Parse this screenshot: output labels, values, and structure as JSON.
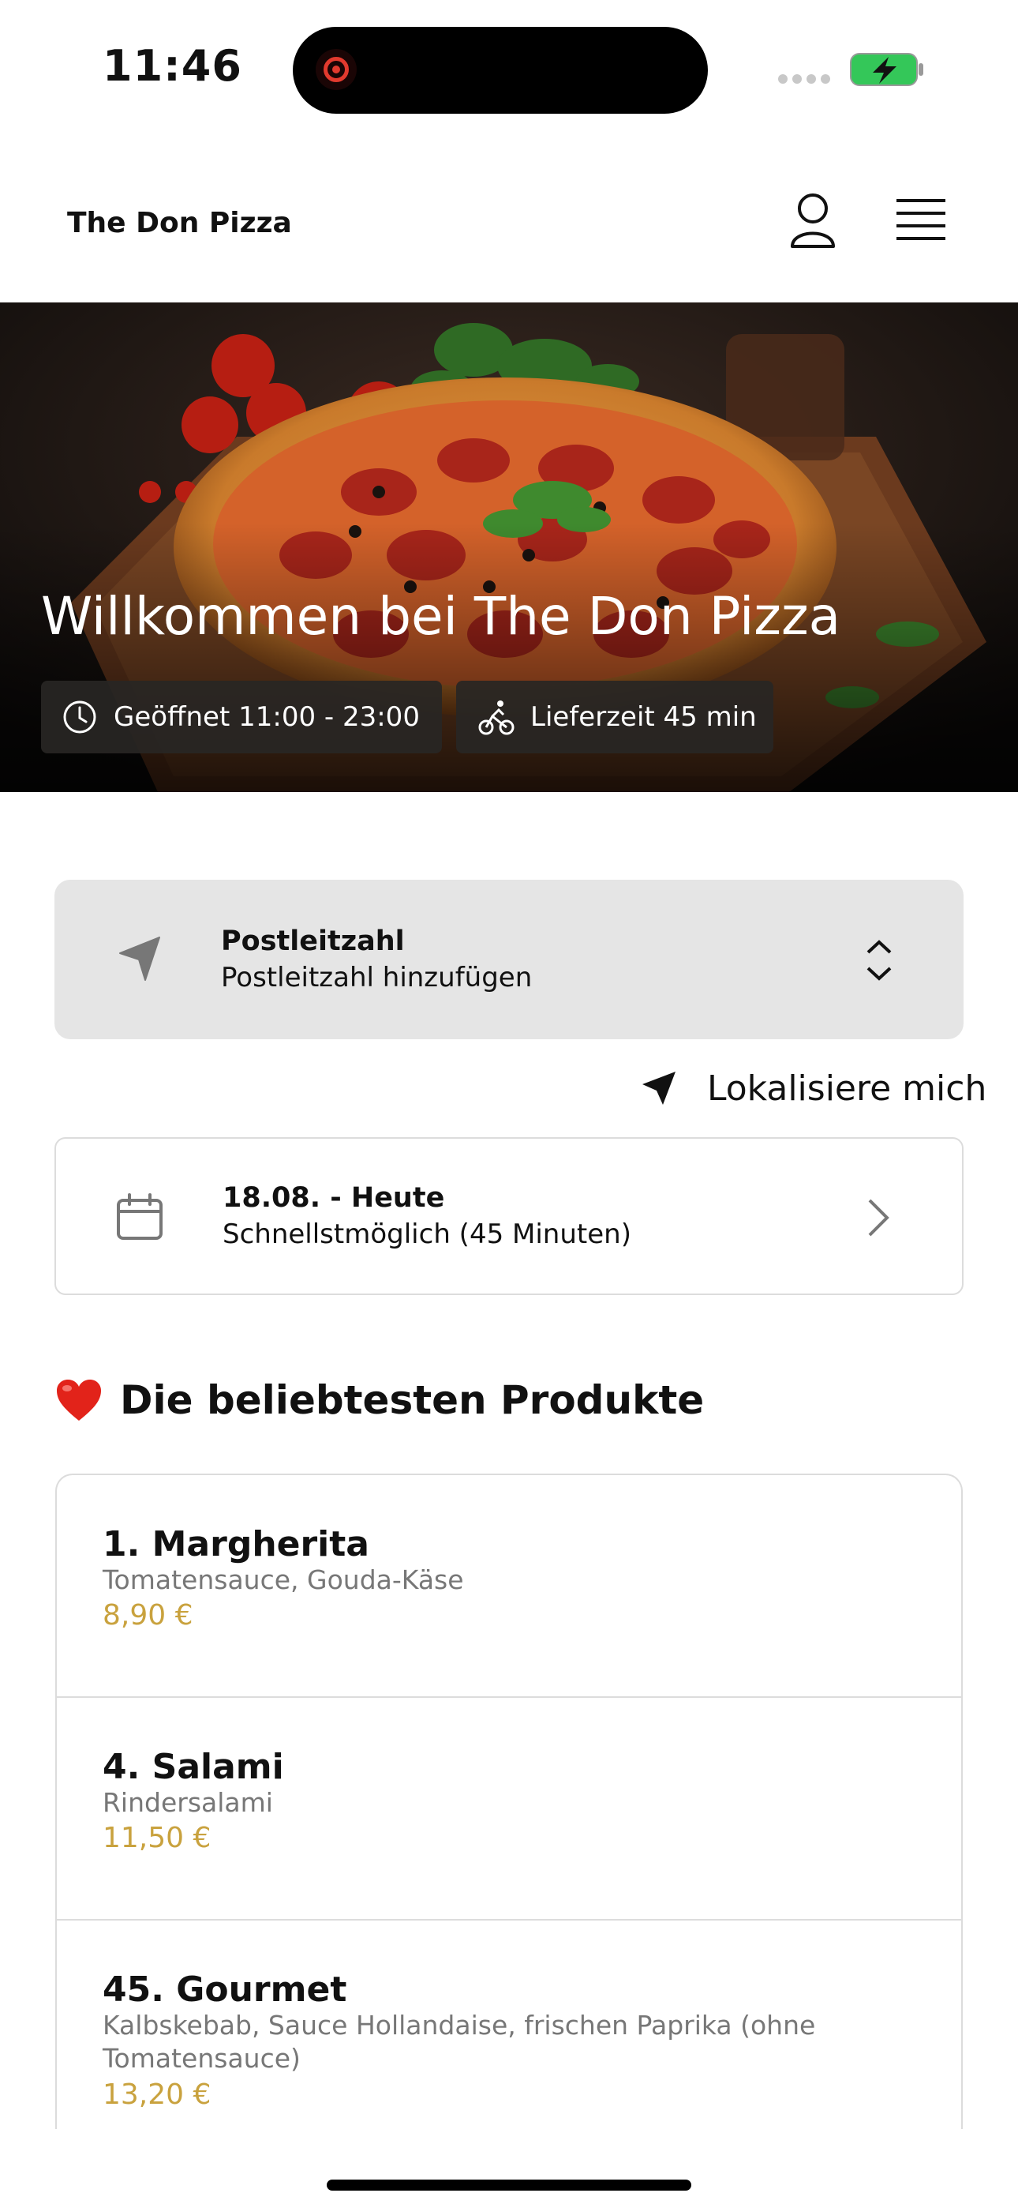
{
  "status_bar": {
    "time": "11:46"
  },
  "header": {
    "brand": "The Don Pizza",
    "icons": [
      "user-icon",
      "menu-icon"
    ]
  },
  "hero": {
    "title": "Willkommen bei The Don Pizza",
    "opening_hours": "Geöffnet 11:00 - 23:00",
    "delivery_time": "Lieferzeit 45 min"
  },
  "postcode": {
    "label": "Postleitzahl",
    "value": "Postleitzahl hinzufügen"
  },
  "locate_me": "Lokalisiere mich",
  "delivery_date": {
    "label": "18.08. - Heute",
    "value": "Schnellstmöglich (45 Minuten)"
  },
  "popular": {
    "title": "Die beliebtesten Produkte",
    "products": [
      {
        "name": "1. Margherita",
        "description": "Tomatensauce, Gouda-Käse",
        "price": "8,90 €"
      },
      {
        "name": "4. Salami",
        "description": "Rindersalami",
        "price": "11,50 €"
      },
      {
        "name": "45. Gourmet",
        "description": "Kalbskebab, Sauce Hollandaise, frischen Paprika (ohne Tomatensauce)",
        "price": "13,20 €"
      }
    ]
  },
  "colors": {
    "price": "#c9a23e",
    "battery": "#34c759",
    "card_bg": "#e5e5e5"
  }
}
